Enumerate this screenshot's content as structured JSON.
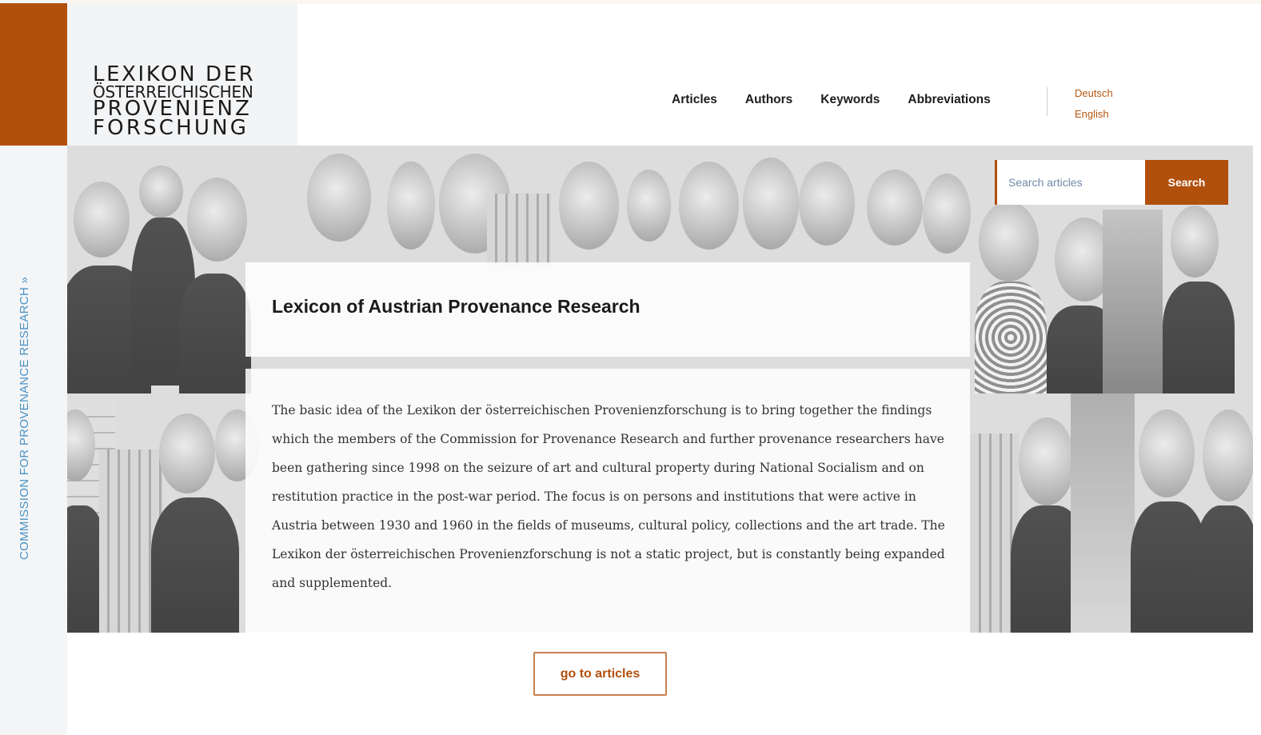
{
  "brand": {
    "logo_lines": [
      "LEXIKON DER",
      "ÖSTERREICHISCHEN",
      "PROVENIENZ",
      "FORSCHUNG"
    ],
    "side_link": "COMMISSION FOR PROVENANCE RESEARCH »",
    "accent_color": "#b14f0c"
  },
  "nav": {
    "items": [
      "Articles",
      "Authors",
      "Keywords",
      "Abbreviations"
    ]
  },
  "languages": [
    "Deutsch",
    "English"
  ],
  "search": {
    "placeholder": "Search articles",
    "button_label": "Search"
  },
  "hero": {
    "title": "Lexicon of Austrian Provenance Research",
    "description": "The basic idea of the Lexikon der österreichischen Provenienzforschung is to bring together the findings which the members of the Commission for Provenance Research and further provenance researchers have been gathering since 1998 on the seizure of art and cultural property during National Socialism and on restitution practice in the post-war period. The focus is on persons and institutions that were active in Austria between 1930 and 1960 in the fields of museums, cultural policy, collections and the art trade. The Lexikon der österreichischen Provenienzforschung is not a static project, but is constantly being expanded and supplemented.",
    "cta_label": "go to articles"
  }
}
